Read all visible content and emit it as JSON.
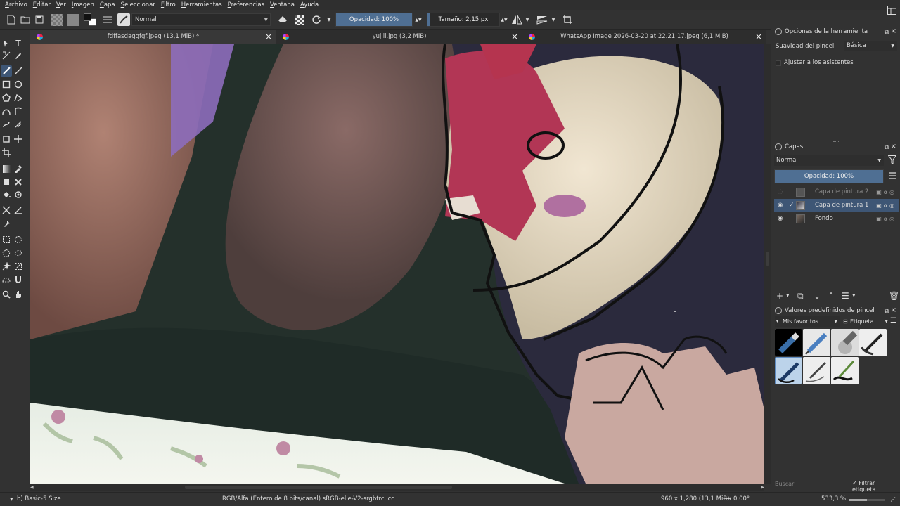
{
  "menu": [
    "Archivo",
    "Editar",
    "Ver",
    "Imagen",
    "Capa",
    "Seleccionar",
    "Filtro",
    "Herramientas",
    "Preferencias",
    "Ventana",
    "Ayuda"
  ],
  "toolbar": {
    "blend_mode": "Normal",
    "opacity_label": "Opacidad: 100%",
    "opacity_value": 1.0,
    "size_label": "Tamaño: 2,15 px",
    "size_value": 0.04
  },
  "tabs": [
    {
      "label": "fdffasdaggfgf.jpeg (13,1 MiB) *",
      "active": true
    },
    {
      "label": "yujiii.jpg (3,2 MiB)",
      "active": false
    },
    {
      "label": "WhatsApp Image 2026-03-20 at 22.21.17.jpeg (6,1 MiB)",
      "active": false
    }
  ],
  "tool_options": {
    "title": "Opciones de la herramienta",
    "smoothing_label": "Suavidad del pincel:",
    "smoothing_value": "Básica",
    "assistants_label": "Ajustar a los asistentes"
  },
  "layers": {
    "title": "Capas",
    "blend_mode": "Normal",
    "opacity_label": "Opacidad:  100%",
    "opacity_value": 1.0,
    "items": [
      {
        "name": "Capa de pintura 2",
        "visible": false,
        "selected": false,
        "checked": false
      },
      {
        "name": "Capa de pintura 1",
        "visible": true,
        "selected": true,
        "checked": true
      },
      {
        "name": "Fondo",
        "visible": true,
        "selected": false,
        "checked": false
      }
    ]
  },
  "brush_presets": {
    "title": "Valores predefinidos de pincel",
    "tag_select": "Mis favoritos",
    "tag_button": "Etiqueta",
    "search_placeholder": "Buscar",
    "filter_label": "Filtrar etiqueta",
    "filter_checked": true
  },
  "status": {
    "brush": "b) Basic-5 Size",
    "color_space": "RGB/Alfa (Entero de 8 bits/canal)  sRGB-elle-V2-srgbtrc.icc",
    "dimensions": "960 x 1,280 (13,1 MiB)",
    "rotation": "0,00°",
    "zoom": "533,3 %"
  },
  "colors": {
    "accent": "#4f6f93",
    "selection": "#3e5675",
    "panel": "#323232"
  }
}
